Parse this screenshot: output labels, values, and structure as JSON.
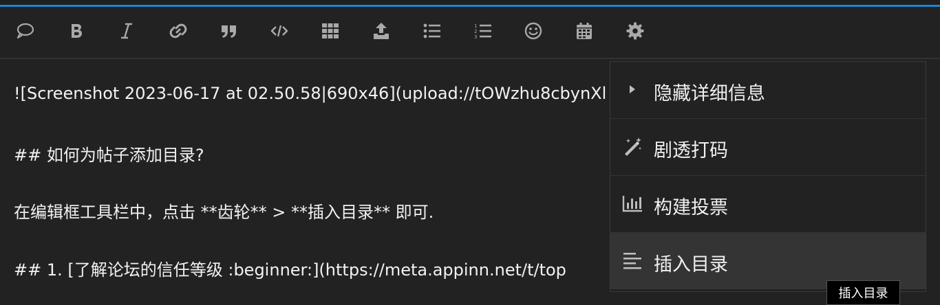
{
  "colors": {
    "accent": "#1b86d6",
    "background": "#222222",
    "icon": "#a9a9a9",
    "text": "#f2f2f2",
    "active_item": "#343434"
  },
  "toolbar": {
    "buttons": [
      {
        "icon": "speech-bubble-icon"
      },
      {
        "icon": "bold-icon"
      },
      {
        "icon": "italic-icon"
      },
      {
        "icon": "link-icon"
      },
      {
        "icon": "quote-icon"
      },
      {
        "icon": "code-icon"
      },
      {
        "icon": "table-grid-icon"
      },
      {
        "icon": "upload-icon"
      },
      {
        "icon": "bulleted-list-icon"
      },
      {
        "icon": "numbered-list-icon"
      },
      {
        "icon": "emoji-icon"
      },
      {
        "icon": "calendar-icon"
      },
      {
        "icon": "gear-icon"
      }
    ]
  },
  "editor": {
    "lines": [
      "![Screenshot 2023-06-17 at 02.50.58|690x46](upload://tOWzhu8cbynXl",
      "## 如何为帖子添加目录?",
      "在编辑框工具栏中，点击 **齿轮** > **插入目录** 即可.",
      "## 1. [了解论坛的信任等级 :beginner:](https://meta.appinn.net/t/top"
    ]
  },
  "menu": {
    "items": [
      {
        "label": "隐藏详细信息",
        "icon": "caret-right-icon"
      },
      {
        "label": "剧透打码",
        "icon": "magic-wand-icon"
      },
      {
        "label": "构建投票",
        "icon": "bar-chart-icon"
      },
      {
        "label": "插入目录",
        "icon": "align-left-icon"
      }
    ]
  },
  "tooltip": {
    "text": "插入目录"
  }
}
